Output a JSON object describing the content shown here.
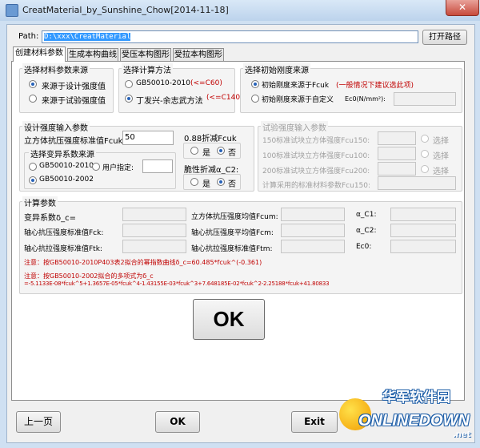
{
  "window": {
    "title": "CreatMaterial_by_Sunshine_Chow[2014-11-18]",
    "close": "✕"
  },
  "path": {
    "label": "Path:",
    "value": "D:\\xxx\\CreatMaterial",
    "open_button": "打开路径"
  },
  "tabs": [
    "创建材料参数",
    "生成本构曲线",
    "受压本构图形",
    "受拉本构图形"
  ],
  "material_source": {
    "title": "选择材料参数来源",
    "options": [
      "来源于设计强度值",
      "来源于试验强度值"
    ],
    "selected": 0
  },
  "calc_method": {
    "title": "选择计算方法",
    "options": [
      {
        "label": "GB50010-2010",
        "note": "(<=C60)"
      },
      {
        "label": "丁发兴-余志武方法",
        "note": "(<=C140)"
      }
    ],
    "selected": 1
  },
  "stiffness": {
    "title": "选择初始刚度来源",
    "options": [
      "初始刚度来源于Fcuk",
      "初始刚度来源于自定义"
    ],
    "selected": 0,
    "note": "(一般情况下建议选此项)",
    "ec0_label": "Ec0(N/mm²):"
  },
  "design_input": {
    "title": "设计强度输入参数",
    "fcuk_label": "立方体抗压强度标准值Fcuk:",
    "fcuk_value": "50"
  },
  "variation": {
    "title": "选择变异系数来源",
    "options": [
      "GB50010-2010",
      "用户指定:",
      "GB50010-2002"
    ],
    "selected": 2
  },
  "reduce": {
    "title": "0.88折减Fcuk",
    "yes": "是",
    "no": "否",
    "selected": "no"
  },
  "brittle": {
    "title": "脆性折减α_C2:",
    "yes": "是",
    "no": "否",
    "selected": "no"
  },
  "test_input": {
    "title": "试验强度输入参数",
    "rows": [
      "150标准试块立方体强度Fcu150:",
      "100标准试块立方体强度Fcu100:",
      "200标准试块立方体强度Fcu200:"
    ],
    "choose": "选择",
    "std_label": "计算采用的标准材料参数Fcu150:"
  },
  "calc_params": {
    "title": "计算参数",
    "labels": {
      "delta": "变异系数δ_c=",
      "fcm_cube": "立方体抗压强度均值Fcum:",
      "a_c1": "α_C1:",
      "fck": "轴心抗压强度标准值Fck:",
      "fcm": "轴心抗压强度平均值Fcm:",
      "a_c2": "α_C2:",
      "ftk": "轴心抗拉强度标准值Ftk:",
      "ftm": "轴心抗拉强度标准值Ftm:",
      "ec0": "Ec0:"
    }
  },
  "notes": {
    "note1": "注意：按GB50010-2010P403表2拟合的幂指数曲线δ_c=60.485*fcuk^(-0.361)",
    "note2a": "注意：按GB50010-2002拟合的多项式为δ_c",
    "note2b": "=-5.1133E-08*fcuk^5+1.3657E-05*fcuk^4-1.43155E-03*fcuk^3+7.648185E-02*fcuk^2-2.25188*fcuk+41.80833"
  },
  "ok_big": "OK",
  "bottom": {
    "prev": "上一页",
    "ok": "OK",
    "exit": "Exit"
  },
  "watermark": {
    "cn": "华军软件园",
    "en": "ONLINEDOWN",
    "suffix": ".net"
  }
}
